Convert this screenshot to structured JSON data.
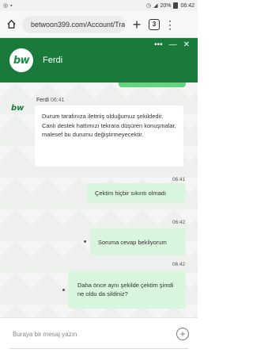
{
  "status_bar": {
    "battery": "20%",
    "time": "06:42",
    "icons": [
      "whatsapp-icon",
      "notification-icon",
      "alarm-icon",
      "signal-icon",
      "battery-icon"
    ]
  },
  "browser": {
    "url": "betwoon399.com/Account/Tra",
    "tab_count": "3"
  },
  "chat": {
    "agent_name": "Ferdi",
    "brand_logo": "bw",
    "brand_color": "#1a7a3c",
    "accent_light": "#d9f5dd",
    "messages": [
      {
        "sender": "Ferdi",
        "time": "06:41",
        "text": "Durum tarafınıza iletmiş olduğumuz şekildedir. Canlı destek hattımızı tekrara düşüren konuşmalar, malesef bu durumu değiştirmeyecektir."
      },
      {
        "time": "06:41",
        "text": "Çektim hiçbir sıkıntı olmadı"
      },
      {
        "time": "06:42",
        "text": "Soruma cevap bekliyorum"
      },
      {
        "time": "06:42",
        "text": "Daha önce aynı şekilde çektim şimdi ne oldu da sildiniz?"
      }
    ],
    "input_placeholder": "Buraya bir mesaj yazın"
  }
}
